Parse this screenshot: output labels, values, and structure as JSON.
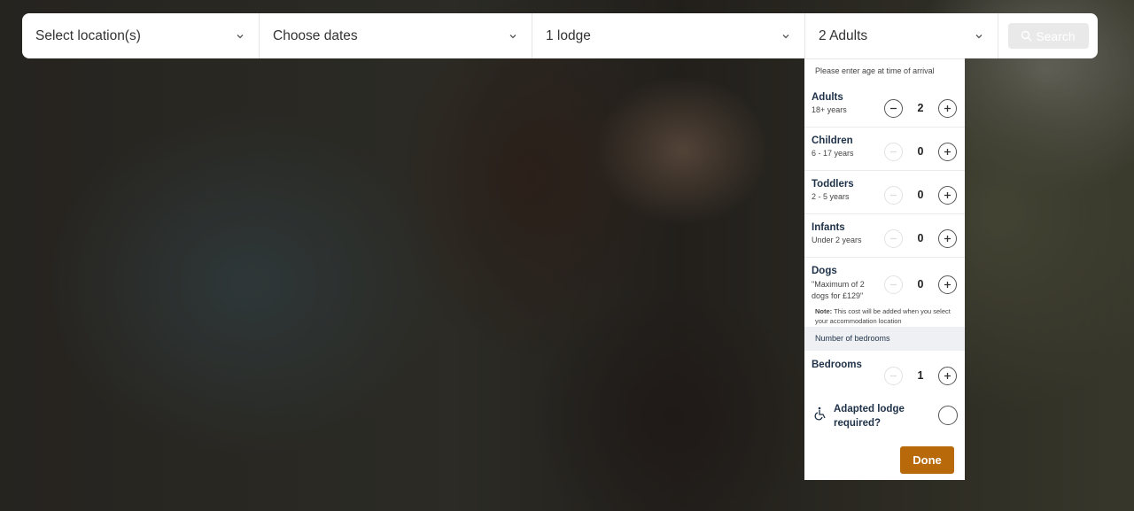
{
  "search_bar": {
    "location_placeholder": "Select location(s)",
    "dates_placeholder": "Choose dates",
    "lodge_value": "1 lodge",
    "guests_value": "2 Adults",
    "search_label": "Search"
  },
  "guests_panel": {
    "hint": "Please enter age at time of arrival",
    "rows": [
      {
        "title": "Adults",
        "sub": "18+ years",
        "count": "2",
        "minus_enabled": true
      },
      {
        "title": "Children",
        "sub": "6 - 17 years",
        "count": "0",
        "minus_enabled": false
      },
      {
        "title": "Toddlers",
        "sub": "2 - 5 years",
        "count": "0",
        "minus_enabled": false
      },
      {
        "title": "Infants",
        "sub": "Under 2 years",
        "count": "0",
        "minus_enabled": false
      },
      {
        "title": "Dogs",
        "sub": "\"Maximum of 2 dogs for £129\"",
        "count": "0",
        "minus_enabled": false
      }
    ],
    "note_bold": "Note:",
    "note_text": " This cost will be added when you select your accommodation location",
    "bedrooms_section": "Number of bedrooms",
    "bedrooms": {
      "title": "Bedrooms",
      "count": "1",
      "minus_enabled": false
    },
    "adapted_label": "Adapted lodge required?",
    "done_label": "Done"
  },
  "colors": {
    "done_button": "#b86a0a",
    "heading_text": "#1e3148",
    "search_button_disabled": "#e9e9e9"
  }
}
